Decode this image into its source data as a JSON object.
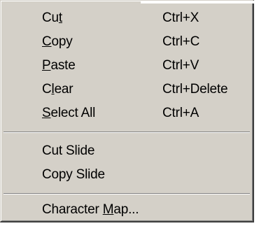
{
  "context_menu": {
    "items": [
      {
        "label_pre": "Cu",
        "label_u": "t",
        "label_post": "",
        "shortcut": "Ctrl+X"
      },
      {
        "label_pre": "",
        "label_u": "C",
        "label_post": "opy",
        "shortcut": "Ctrl+C"
      },
      {
        "label_pre": "",
        "label_u": "P",
        "label_post": "aste",
        "shortcut": "Ctrl+V"
      },
      {
        "label_pre": "C",
        "label_u": "l",
        "label_post": "ear",
        "shortcut": "Ctrl+Delete"
      },
      {
        "label_pre": "",
        "label_u": "S",
        "label_post": "elect All",
        "shortcut": "Ctrl+A"
      },
      {
        "label_pre": "Cut Slide",
        "label_u": "",
        "label_post": "",
        "shortcut": ""
      },
      {
        "label_pre": "Copy Slide",
        "label_u": "",
        "label_post": "",
        "shortcut": ""
      },
      {
        "label_pre": "Character ",
        "label_u": "M",
        "label_post": "ap...",
        "shortcut": ""
      }
    ]
  },
  "colors": {
    "menu_face": "#d4d0c8",
    "text": "#000000",
    "separator_dark": "#808080",
    "separator_light": "#ffffff"
  }
}
